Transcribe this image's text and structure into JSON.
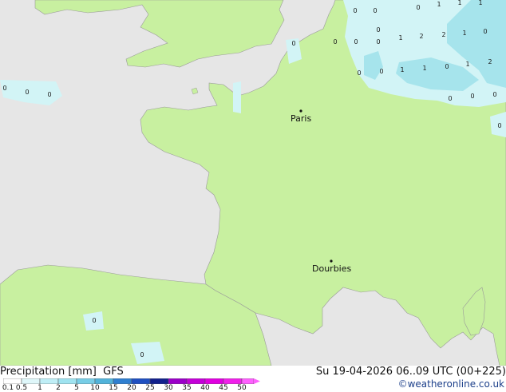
{
  "map": {
    "cities": [
      {
        "id": "paris",
        "name": "Paris"
      },
      {
        "id": "dourbies",
        "name": "Dourbies"
      }
    ],
    "value_labels": [
      "0",
      "0",
      "0",
      "1",
      "1",
      "1",
      "0",
      "1",
      "2",
      "2",
      "1",
      "0",
      "0",
      "0",
      "0",
      "0",
      "1",
      "1",
      "0",
      "1",
      "2",
      "0",
      "0",
      "0",
      "0",
      "0",
      "0",
      "0",
      "0",
      "0",
      "0",
      "0"
    ],
    "colors": {
      "sea": "#e6e6e6",
      "land": "#c8f0a0",
      "precip_light": "#d2f4f6",
      "precip_medium": "#a6e4ec",
      "precip_heavy": "#8fd6e6",
      "border": "#9a9a9a"
    }
  },
  "footer": {
    "title": "Precipitation [mm]",
    "model": "GFS",
    "valid_time": "Su 19-04-2026 06..09 UTC (00+225)",
    "credit": "©weatheronline.co.uk"
  },
  "legend": {
    "labels": [
      "0.1",
      "0.5",
      "1",
      "2",
      "5",
      "10",
      "15",
      "20",
      "25",
      "30",
      "35",
      "40",
      "45",
      "50"
    ],
    "colors": [
      "#ffffff",
      "#dff7fa",
      "#bfeef6",
      "#9fe3f0",
      "#77cde6",
      "#52b3da",
      "#2f7fd0",
      "#1f4fc0",
      "#12208c",
      "#9a00c8",
      "#c400d8",
      "#e000e0",
      "#f020ea",
      "#ff60ff"
    ]
  }
}
